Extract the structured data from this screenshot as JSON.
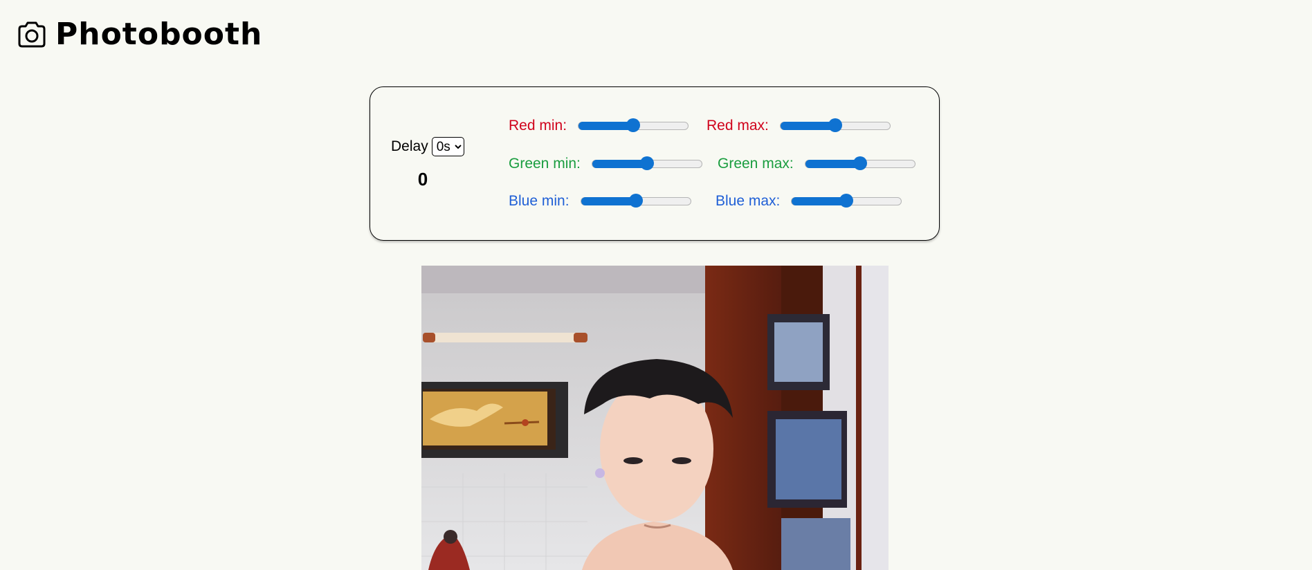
{
  "header": {
    "title": "Photobooth",
    "icon": "camera-icon"
  },
  "controls": {
    "delay_label": "Delay",
    "delay_value": "0s",
    "countdown": "0",
    "sliders": [
      {
        "id": "red-min",
        "label": "Red min:",
        "value": 0.5,
        "color": "#d0021b"
      },
      {
        "id": "red-max",
        "label": "Red max:",
        "value": 0.5,
        "color": "#d0021b"
      },
      {
        "id": "green-min",
        "label": "Green min:",
        "value": 0.5,
        "color": "#1a9d3f"
      },
      {
        "id": "green-max",
        "label": "Green max:",
        "value": 0.5,
        "color": "#1a9d3f"
      },
      {
        "id": "blue-min",
        "label": "Blue min:",
        "value": 0.5,
        "color": "#1f5fd6"
      },
      {
        "id": "blue-max",
        "label": "Blue max:",
        "value": 0.5,
        "color": "#1f5fd6"
      }
    ]
  },
  "colors": {
    "background": "#f8f9f3",
    "slider_accent": "#0f72d1"
  }
}
